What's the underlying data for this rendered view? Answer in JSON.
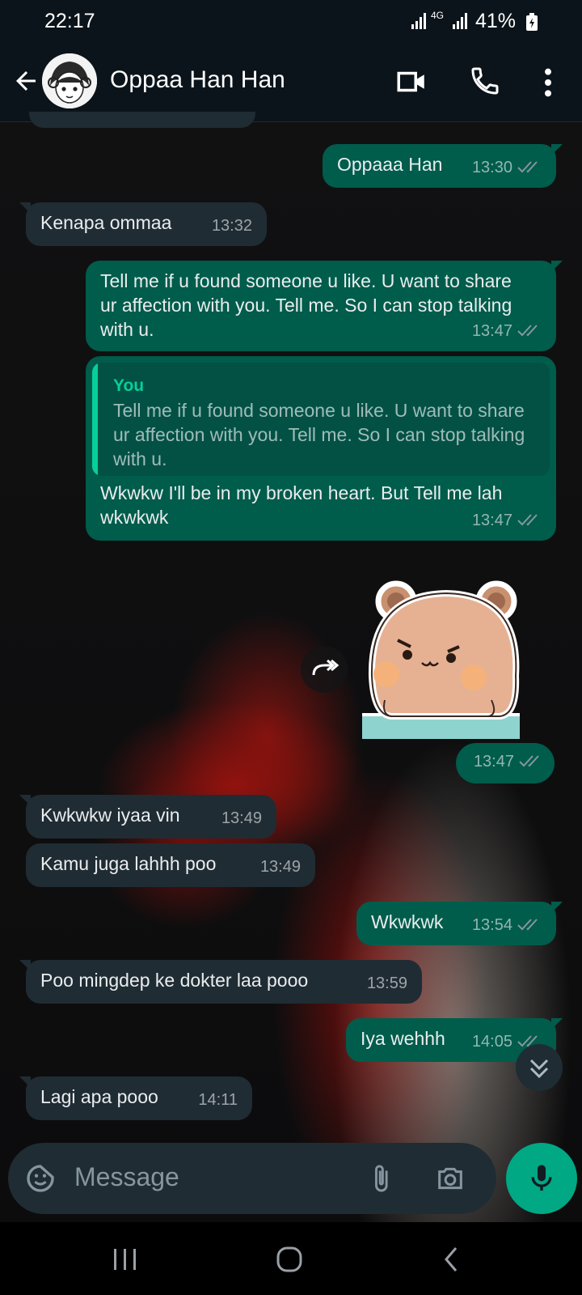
{
  "status_bar": {
    "time": "22:17",
    "network": "4G",
    "battery": "41%"
  },
  "header": {
    "contact_name": "Oppaa Han Han"
  },
  "messages": [
    {
      "dir": "out",
      "text": "Oppaaa Han",
      "time": "13:30"
    },
    {
      "dir": "in",
      "text": "Kenapa ommaa",
      "time": "13:32"
    },
    {
      "dir": "out",
      "text": "Tell me if u found someone u like. U want to share ur affection with you. Tell me. So I can stop talking with u.",
      "time": "13:47"
    },
    {
      "dir": "out",
      "quote_author": "You",
      "quote_text": "Tell me if u found someone u like. U want to share ur affection with you. Tell me. So I can stop talking with u.",
      "text": "Wkwkw I'll be in my broken heart. But Tell me lah wkwkwk",
      "time": "13:47"
    },
    {
      "dir": "out",
      "sticker": "bear-sticker",
      "time": "13:47"
    },
    {
      "dir": "in",
      "text": "Kwkwkw iyaa vin",
      "time": "13:49"
    },
    {
      "dir": "in",
      "text": "Kamu juga lahhh poo",
      "time": "13:49"
    },
    {
      "dir": "out",
      "text": "Wkwkwk",
      "time": "13:54"
    },
    {
      "dir": "in",
      "text": "Poo mingdep ke dokter laa pooo",
      "time": "13:59"
    },
    {
      "dir": "out",
      "text": "Iya wehhh",
      "time": "14:05"
    },
    {
      "dir": "in",
      "text": "Lagi apa pooo",
      "time": "14:11"
    }
  ],
  "input": {
    "placeholder": "Message"
  },
  "colors": {
    "outgoing_bubble": "#005c4b",
    "incoming_bubble": "#202c33",
    "accent": "#00a884",
    "read_ticks": "#8696a0"
  },
  "icons": [
    "back-arrow-icon",
    "video-call-icon",
    "voice-call-icon",
    "more-options-icon",
    "forward-icon",
    "scroll-down-icon",
    "emoji-icon",
    "attach-icon",
    "camera-icon",
    "mic-icon"
  ]
}
